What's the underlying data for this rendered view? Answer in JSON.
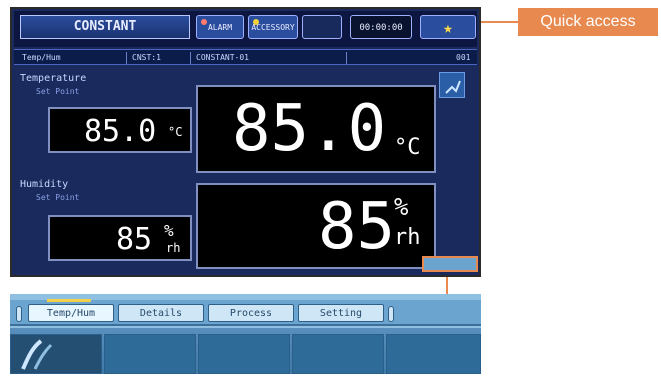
{
  "top": {
    "mode_label": "CONSTANT",
    "alarm_label": "ALARM",
    "accessory_label": "ACCESSORY",
    "dim_label": "",
    "time_label": "00:00:00",
    "star_icon": "star-icon"
  },
  "info": {
    "left_label": "Temp/Hum",
    "program": "CNST:1",
    "constant_id": "CONSTANT-01",
    "right_code": "001"
  },
  "temperature": {
    "title": "Temperature",
    "set_point_label": "Set Point",
    "set_value": "85.0",
    "set_unit": "°C",
    "current_value": "85.0",
    "current_unit": "°C"
  },
  "humidity": {
    "title": "Humidity",
    "set_point_label": "Set Point",
    "set_value": "85",
    "set_unit_top": "%",
    "set_unit_bottom": "rh",
    "current_value": "85",
    "current_unit_top": "%",
    "current_unit_bottom": "rh"
  },
  "callout": {
    "label": "Quick access"
  },
  "strip": {
    "tabs": [
      "Temp/Hum",
      "Details",
      "Process",
      "Setting"
    ],
    "tiles": [
      "",
      "",
      "",
      "",
      ""
    ]
  }
}
